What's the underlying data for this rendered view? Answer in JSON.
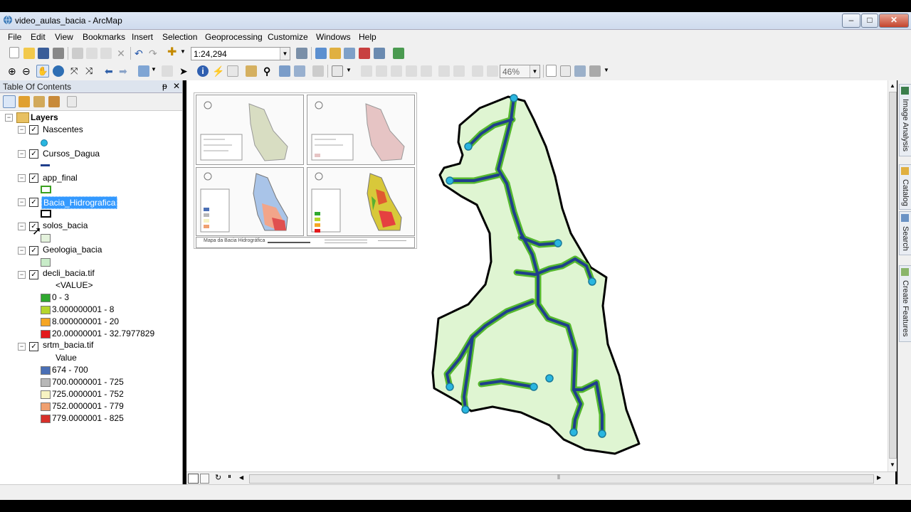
{
  "window": {
    "title": "video_aulas_bacia - ArcMap",
    "minimize": "–",
    "maximize": "□",
    "close": "✕"
  },
  "menu": [
    "File",
    "Edit",
    "View",
    "Bookmarks",
    "Insert",
    "Selection",
    "Geoprocessing",
    "Customize",
    "Windows",
    "Help"
  ],
  "toolbar": {
    "scale": "1:24,294",
    "zoom_level": "46%"
  },
  "toc": {
    "title": "Table Of Contents",
    "pin": "ᵽ",
    "close": "✕",
    "root": "Layers",
    "layers": {
      "nascentes": "Nascentes",
      "cursos": "Cursos_Dagua",
      "app": "app_final",
      "bacia": "Bacia_Hidrografica",
      "solos": "solos_bacia",
      "geologia": "Geologia_bacia",
      "decli": "decli_bacia.tif",
      "decli_field": "<VALUE>",
      "decli_classes": [
        "0 - 3",
        "3.000000001 - 8",
        "8.000000001 - 20",
        "20.00000001 - 32.7977829"
      ],
      "srtm": "srtm_bacia.tif",
      "srtm_field": "Value",
      "srtm_classes": [
        "674 - 700",
        "700.0000001 - 725",
        "725.0000001 - 752",
        "752.0000001 - 779",
        "779.0000001 - 825"
      ]
    },
    "colors": {
      "decli": [
        "#2fa82f",
        "#b5d62c",
        "#f5a623",
        "#e31a1c"
      ],
      "srtm": [
        "#4a6fb5",
        "#b8b8b8",
        "#f7f3c2",
        "#f0a070",
        "#d7302a"
      ]
    }
  },
  "layout_sheet": {
    "title": "Mapa da Bacia Hidrográfica"
  },
  "right_tabs": [
    "Image Analysis",
    "Catalog",
    "Search",
    "Create Features"
  ],
  "map_colors": {
    "basin_fill": "#dff5d2",
    "app_buffer": "#55b82f",
    "stream": "#1f3f8c",
    "spring": "#29b6e0"
  }
}
